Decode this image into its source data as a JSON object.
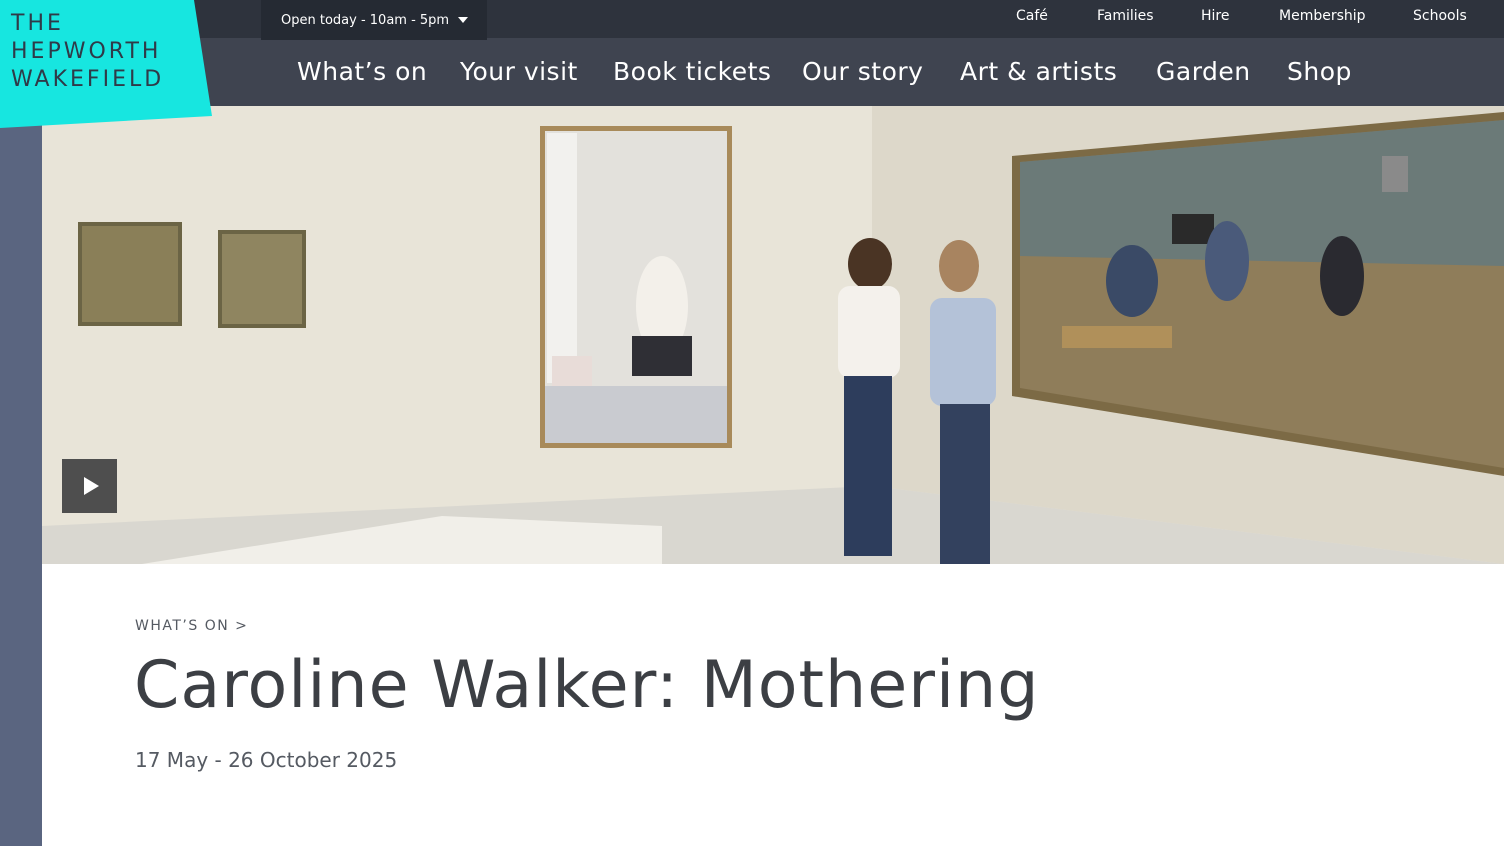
{
  "brand": {
    "line1": "THE",
    "line2": "HEPWORTH",
    "line3": "WAKEFIELD",
    "color": "#17e6e0"
  },
  "hours": {
    "label": "Open today - 10am - 5pm"
  },
  "utility_nav": [
    "Café",
    "Families",
    "Hire",
    "Membership",
    "Schools"
  ],
  "main_nav": [
    "What’s on",
    "Your visit",
    "Book tickets",
    "Our story",
    "Art & artists",
    "Garden",
    "Shop"
  ],
  "hero": {
    "play_icon": "play-icon"
  },
  "breadcrumb": "WHAT’S ON >",
  "page": {
    "title": "Caroline Walker: Mothering",
    "dates": "17 May - 26 October 2025"
  }
}
